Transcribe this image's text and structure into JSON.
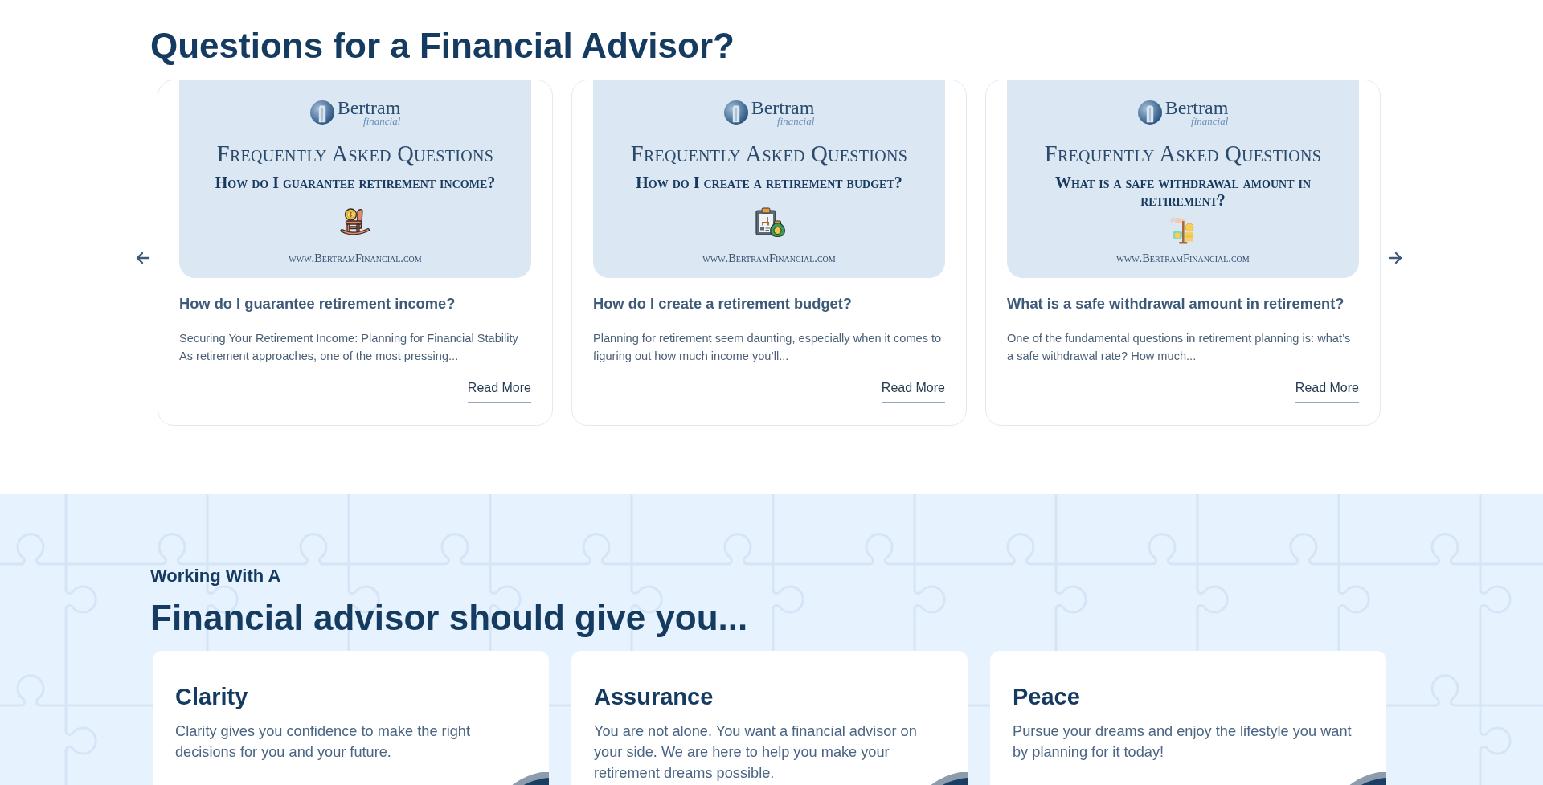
{
  "faq_section": {
    "title": "Questions for a Financial Advisor?",
    "cards": [
      {
        "thumbnail": {
          "brand": "Bertram",
          "brand_tagline": "financial",
          "banner": "Frequently Asked Questions",
          "question": "How do I guarantee retirement income?",
          "website": "www.BertramFinancial.com"
        },
        "title": "How do I guarantee retirement income?",
        "excerpt": "Securing Your Retirement Income: Planning for Financial Stability As retirement approaches, one of the most pressing...",
        "link": "Read More"
      },
      {
        "thumbnail": {
          "brand": "Bertram",
          "brand_tagline": "financial",
          "banner": "Frequently Asked Questions",
          "question": "How do I create a retirement budget?",
          "website": "www.BertramFinancial.com"
        },
        "title": "How do I create a retirement budget?",
        "excerpt": "Planning for retirement seem daunting, especially when it comes to figuring out how much income you’ll...",
        "link": "Read More"
      },
      {
        "thumbnail": {
          "brand": "Bertram",
          "brand_tagline": "financial",
          "banner": "Frequently Asked Questions",
          "question": "What is a safe withdrawal amount in retirement?",
          "website": "www.BertramFinancial.com"
        },
        "title": "What is a safe withdrawal amount in retirement?",
        "excerpt": "One of the fundamental questions in retirement planning is: what’s a safe withdrawal rate? How much...",
        "link": "Read More"
      }
    ]
  },
  "benefits_section": {
    "eyebrow": "Working With A",
    "title": "Financial advisor should give you...",
    "cards": [
      {
        "title": "Clarity",
        "text": "Clarity gives you confidence to make the right decisions for you and your future."
      },
      {
        "title": "Assurance",
        "text": "You are not alone. You want a financial advisor on your side. We are here to help you make your retirement dreams possible."
      },
      {
        "title": "Peace",
        "text": "Pursue your dreams and enjoy the lifestyle you want by planning for it today!"
      }
    ]
  }
}
